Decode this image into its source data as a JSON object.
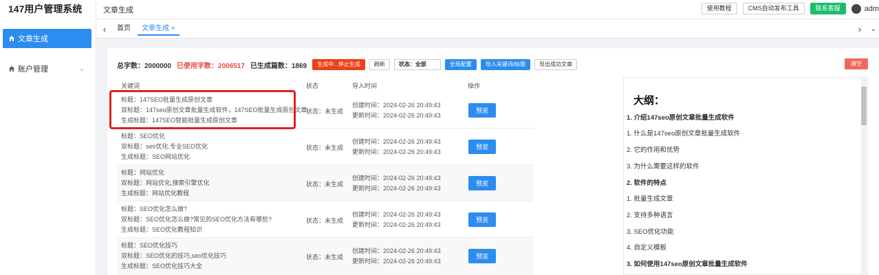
{
  "app": {
    "title": "147用户管理系统"
  },
  "sidebar": {
    "items": [
      {
        "label": "文章生成",
        "icon": "home-icon",
        "active": true
      },
      {
        "label": "账户管理",
        "icon": "home-icon",
        "active": false
      }
    ]
  },
  "header": {
    "breadcrumb": "文章生成",
    "buttons": [
      "使用教程",
      "CMS自动发布工具",
      "联系客服"
    ],
    "user": "adm"
  },
  "tabs": {
    "items": [
      {
        "label": "首页"
      },
      {
        "label": "文章生成 ×"
      }
    ]
  },
  "stats": {
    "total_label": "总字数：2000000",
    "used_label": "已使用字数：2006517",
    "generated_label": "已生成篇数：1869"
  },
  "actions": {
    "stop": "生成中...停止生成",
    "refresh": "刷新",
    "status": "状态：全部",
    "global_config": "全局配置",
    "import": "导入关键词/标题",
    "export": "导出成功文章",
    "clear": "清空"
  },
  "table": {
    "columns": [
      "关键词",
      "状态",
      "导入时间",
      "操作"
    ],
    "preview_label": "预览",
    "rows": [
      {
        "title": "标题：147SEO批量生成原创文章",
        "double": "双标题：147seo原创文章批量生成软件，147SEO批量生成原创文章",
        "gen": "生成标题：147SEO智能批量生成原创文章",
        "status": "状态：未生成",
        "created": "创建时间：2024-02-26 20:49:43",
        "updated": "更新时间：2024-02-26 20:49:43"
      },
      {
        "title": "标题：SEO优化",
        "double": "双标题：seo优化,专业SEO优化",
        "gen": "生成标题：SEO网站优化",
        "status": "状态：未生成",
        "created": "创建时间：2024-02-26 20:49:43",
        "updated": "更新时间：2024-02-26 20:49:43"
      },
      {
        "title": "标题：网站优化",
        "double": "双标题：网站优化,搜索引擎优化",
        "gen": "生成标题：网站优化教程",
        "status": "状态：未生成",
        "created": "创建时间：2024-02-26 20:49:43",
        "updated": "更新时间：2024-02-26 20:49:43"
      },
      {
        "title": "标题：SEO优化怎么做?",
        "double": "双标题：SEO优化怎么做?常见的SEO优化方法有哪些?",
        "gen": "生成标题：SEO优化教程知识",
        "status": "状态：未生成",
        "created": "创建时间：2024-02-26 20:49:43",
        "updated": "更新时间：2024-02-26 20:49:43"
      },
      {
        "title": "标题：SEO优化技巧",
        "double": "双标题：SEO优化的技巧,seo优化技巧",
        "gen": "生成标题：SEO优化技巧大全",
        "status": "状态：未生成",
        "created": "创建时间：2024-02-26 20:49:43",
        "updated": "更新时间：2024-02-26 20:49:43"
      }
    ]
  },
  "outline": {
    "title": "大纲：",
    "items": [
      {
        "text": "1. 介绍147seo原创文章批量生成软件",
        "bold": true
      },
      {
        "text": "1. 什么是147seo原创文章批量生成软件",
        "bold": false
      },
      {
        "text": "2. 它的作用和优势",
        "bold": false
      },
      {
        "text": "3. 为什么需要这样的软件",
        "bold": false
      },
      {
        "text": "2. 软件的特点",
        "bold": true
      },
      {
        "text": "1. 批量生成文章",
        "bold": false
      },
      {
        "text": "2. 支持多种语言",
        "bold": false
      },
      {
        "text": "3. SEO优化功能",
        "bold": false
      },
      {
        "text": "4. 自定义模板",
        "bold": false
      },
      {
        "text": "3. 如何使用147seo原创文章批量生成软件",
        "bold": true
      }
    ]
  },
  "colors": {
    "primary": "#2d8cf0",
    "danger": "#ed4014",
    "success": "#19be6b",
    "highlight": "#e02020"
  }
}
